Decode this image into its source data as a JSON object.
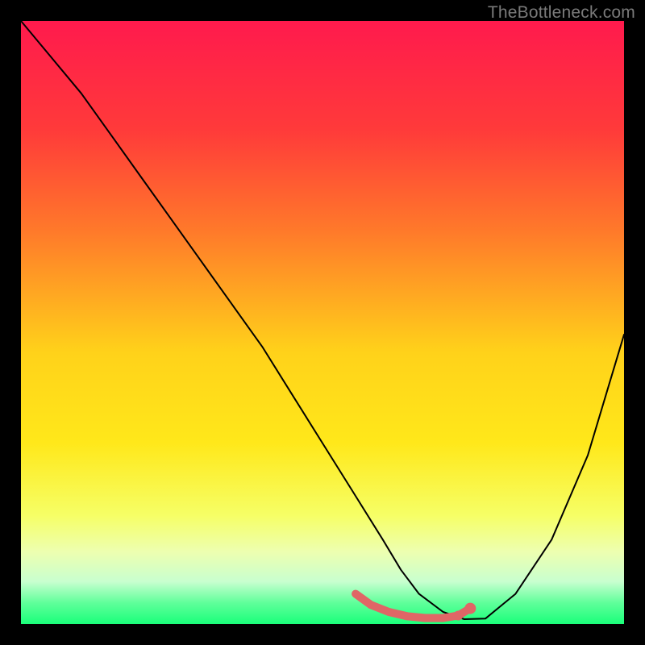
{
  "attribution": "TheBottleneck.com",
  "chart_data": {
    "type": "line",
    "title": "",
    "xlabel": "",
    "ylabel": "",
    "xlim": [
      0,
      100
    ],
    "ylim": [
      0,
      100
    ],
    "gradient": {
      "stops": [
        {
          "offset": 0.0,
          "color": "#ff1a4d"
        },
        {
          "offset": 0.18,
          "color": "#ff3a3a"
        },
        {
          "offset": 0.35,
          "color": "#ff7a2a"
        },
        {
          "offset": 0.55,
          "color": "#ffd21a"
        },
        {
          "offset": 0.7,
          "color": "#ffe81a"
        },
        {
          "offset": 0.82,
          "color": "#f6ff66"
        },
        {
          "offset": 0.88,
          "color": "#edffb0"
        },
        {
          "offset": 0.93,
          "color": "#c8ffcf"
        },
        {
          "offset": 0.965,
          "color": "#5fff9a"
        },
        {
          "offset": 1.0,
          "color": "#1aff7a"
        }
      ]
    },
    "series": [
      {
        "name": "bottleneck-curve",
        "color": "#000000",
        "stroke_width": 2,
        "x": [
          0,
          5,
          10,
          15,
          20,
          25,
          30,
          35,
          40,
          45,
          50,
          55,
          60,
          63,
          66,
          70,
          73.5,
          77,
          82,
          88,
          94,
          100
        ],
        "values": [
          100,
          94,
          88,
          81,
          74,
          67,
          60,
          53,
          46,
          38,
          30,
          22,
          14,
          9,
          5,
          2,
          0.8,
          0.9,
          5,
          14,
          28,
          48
        ]
      }
    ],
    "marker_band": {
      "name": "optimal-range",
      "color": "#e06666",
      "xs": [
        55.5,
        58,
        61,
        64,
        67,
        70,
        72.5,
        74.5
      ],
      "ys": [
        5.0,
        3.2,
        2.0,
        1.3,
        1.0,
        1.0,
        1.4,
        2.6
      ],
      "radii": [
        4.5,
        5,
        5,
        5,
        5,
        5,
        6,
        7
      ]
    }
  }
}
